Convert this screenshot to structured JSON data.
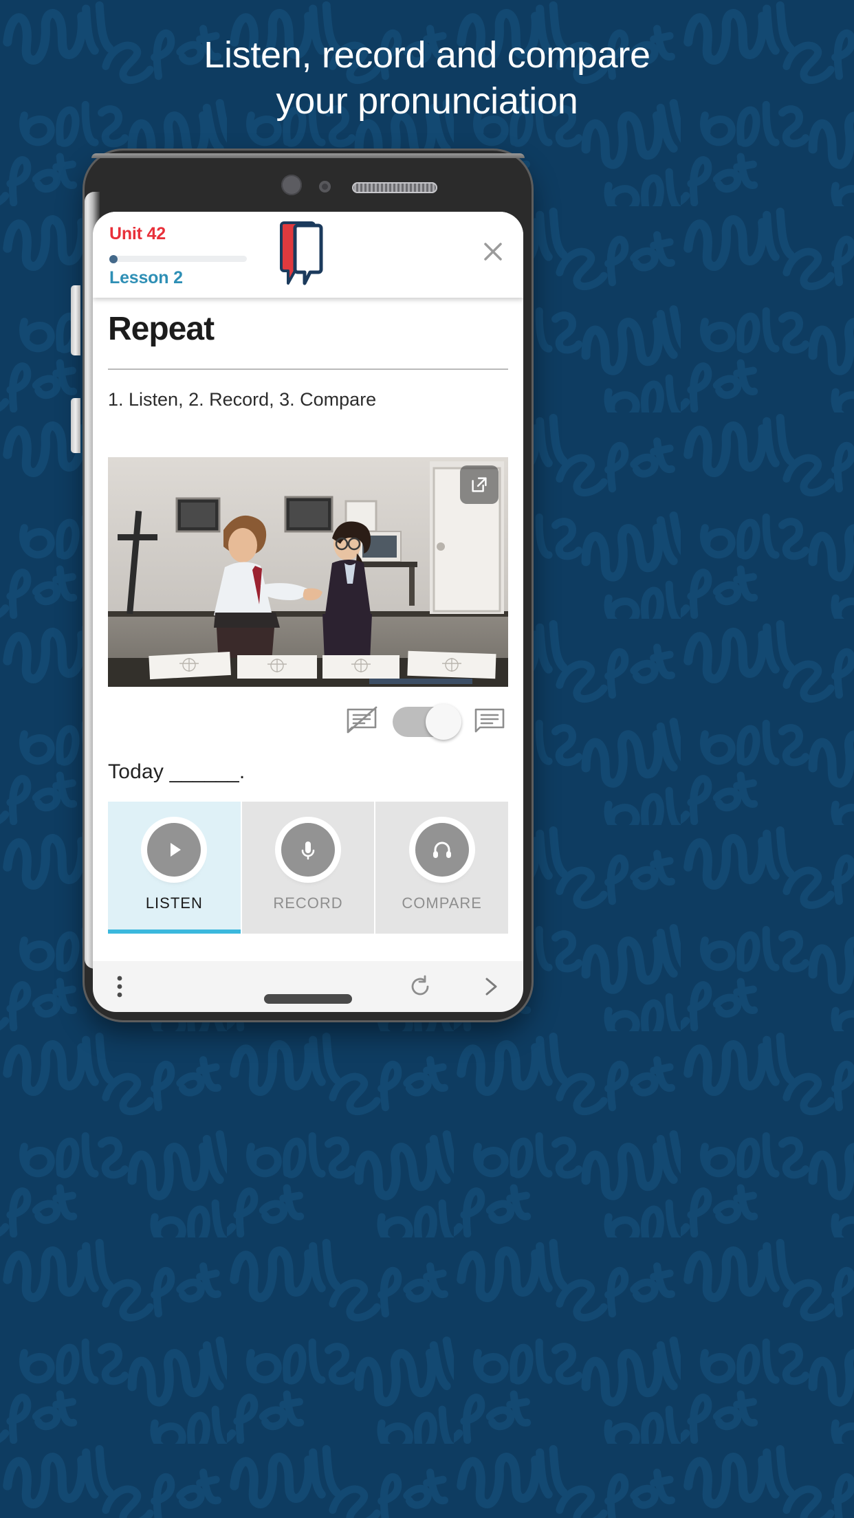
{
  "headline": {
    "line1": "Listen, record and compare",
    "line2": "your pronunciation"
  },
  "colors": {
    "background": "#0e3c61",
    "unit_red": "#e8303a",
    "lesson_teal": "#2e8fb5",
    "active_tab_bg": "#dff1f7",
    "active_underline": "#3bb8dd",
    "inactive_tab_bg": "#e4e4e4"
  },
  "phone": {
    "hardware": {
      "camera": "camera-icon",
      "sensor": "proximity-sensor-icon",
      "speaker": "earpiece-speaker"
    }
  },
  "app_header": {
    "unit": "Unit 42",
    "lesson": "Lesson 2",
    "progress_percent": 2,
    "logo_name": "english-attack-logo",
    "close_icon": "close-icon"
  },
  "content": {
    "exercise_title": "Repeat",
    "instruction": "1. Listen, 2. Record, 3. Compare",
    "video": {
      "expand_icon": "expand-icon",
      "description": "Two colleagues talking in an office"
    },
    "subtitles": {
      "off_icon": "subtitles-off-icon",
      "on_icon": "subtitles-on-icon",
      "toggle_state": "on"
    },
    "sentence": "Today ______."
  },
  "actions": [
    {
      "label": "LISTEN",
      "icon": "play-icon",
      "state": "active"
    },
    {
      "label": "RECORD",
      "icon": "microphone-icon",
      "state": "inactive"
    },
    {
      "label": "COMPARE",
      "icon": "headphones-icon",
      "state": "inactive"
    }
  ],
  "navbar": {
    "menu_icon": "more-vertical-icon",
    "replay_icon": "replay-icon",
    "next_icon": "chevron-right-icon"
  }
}
